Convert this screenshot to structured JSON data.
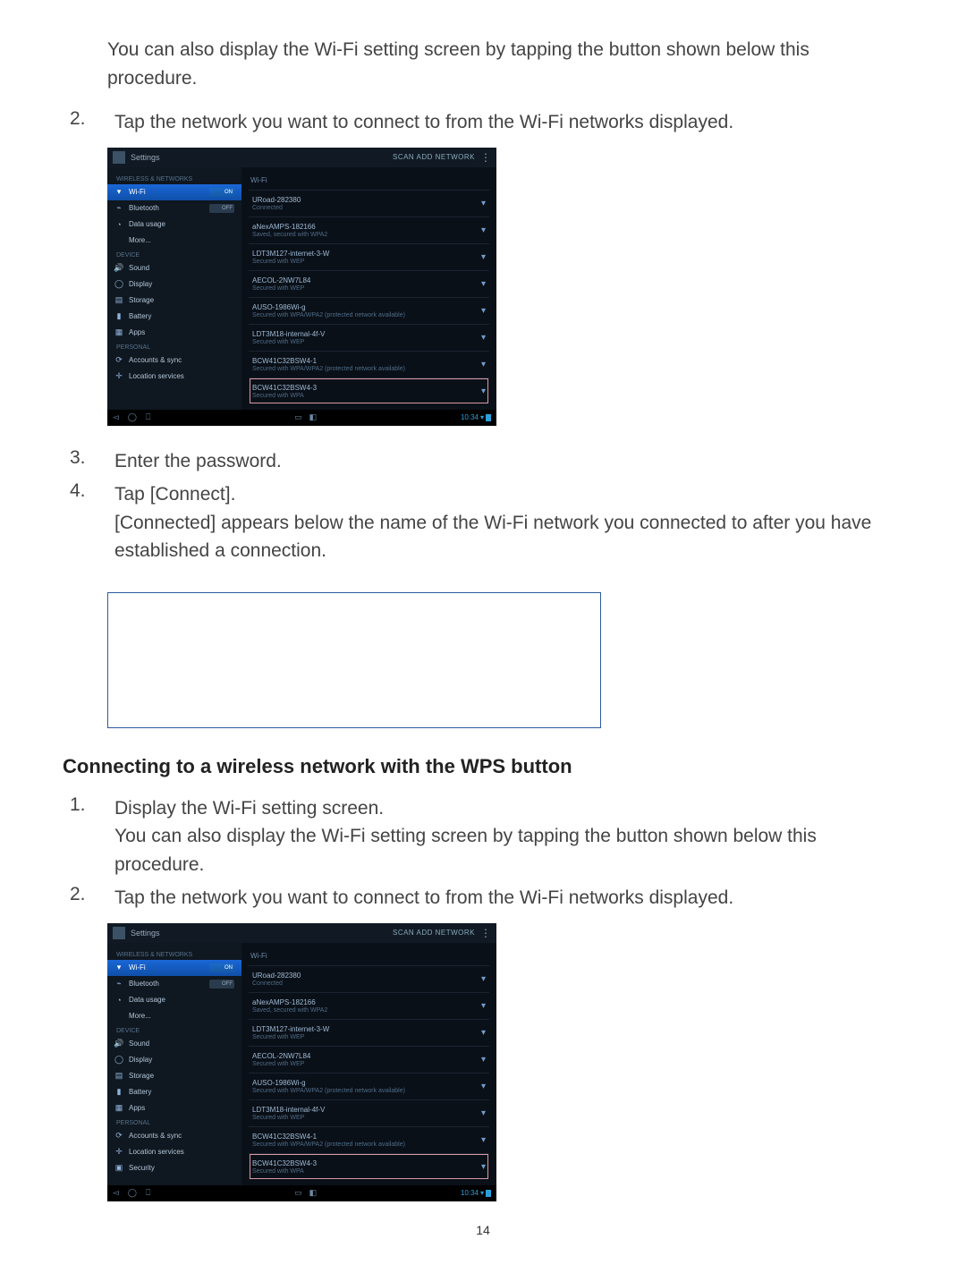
{
  "intro_para": "You can also display the Wi-Fi setting screen by tapping the button shown below this procedure.",
  "step2_num": "2.",
  "step2_text": "Tap the network you want to connect to from the Wi-Fi networks displayed.",
  "step3_num": "3.",
  "step3_text": "Enter the password.",
  "step4_num": "4.",
  "step4_line1": "Tap [Connect].",
  "step4_line2": "[Connected] appears below the name of the Wi-Fi network you connected to after you have established a connection.",
  "heading_wps": "Connecting to a wireless network with the WPS button",
  "wps_step1_num": "1.",
  "wps_step1_line1": "Display the Wi-Fi setting screen.",
  "wps_step1_line2": "You can also display the Wi-Fi setting screen by tapping the button shown below this procedure.",
  "wps_step2_num": "2.",
  "wps_step2_text": "Tap the network you want to connect to from the Wi-Fi networks displayed.",
  "page_number": "14",
  "screenshot": {
    "title": "Settings",
    "top_right": "SCAN   ADD NETWORK",
    "main_head": "Wi-Fi",
    "sidebar_section_1": "WIRELESS & NETWORKS",
    "sidebar_section_2": "DEVICE",
    "sidebar_section_3": "PERSONAL",
    "toggle_on": "ON",
    "toggle_off": "OFF",
    "sidebar": {
      "wifi": "Wi-Fi",
      "bluetooth": "Bluetooth",
      "data": "Data usage",
      "more": "More...",
      "sound": "Sound",
      "display": "Display",
      "storage": "Storage",
      "battery": "Battery",
      "apps": "Apps",
      "accounts": "Accounts & sync",
      "location": "Location services",
      "security": "Security"
    },
    "networks": [
      {
        "name": "URoad-282380",
        "sub": "Connected"
      },
      {
        "name": "aNexAMPS-182166",
        "sub": "Saved, secured with WPA2"
      },
      {
        "name": "LDT3M127-internet-3-W",
        "sub": "Secured with WEP"
      },
      {
        "name": "AECOL-2NW7L84",
        "sub": "Secured with WEP"
      },
      {
        "name": "AUSO-1986Wi-g",
        "sub": "Secured with WPA/WPA2 (protected network available)"
      },
      {
        "name": "LDT3M18-internal-4f-V",
        "sub": "Secured with WEP"
      },
      {
        "name": "BCW41C32BSW4-1",
        "sub": "Secured with WPA/WPA2 (protected network available)"
      },
      {
        "name": "BCW41C32BSW4-3",
        "sub": "Secured with WPA"
      }
    ],
    "clock": "10:34"
  }
}
